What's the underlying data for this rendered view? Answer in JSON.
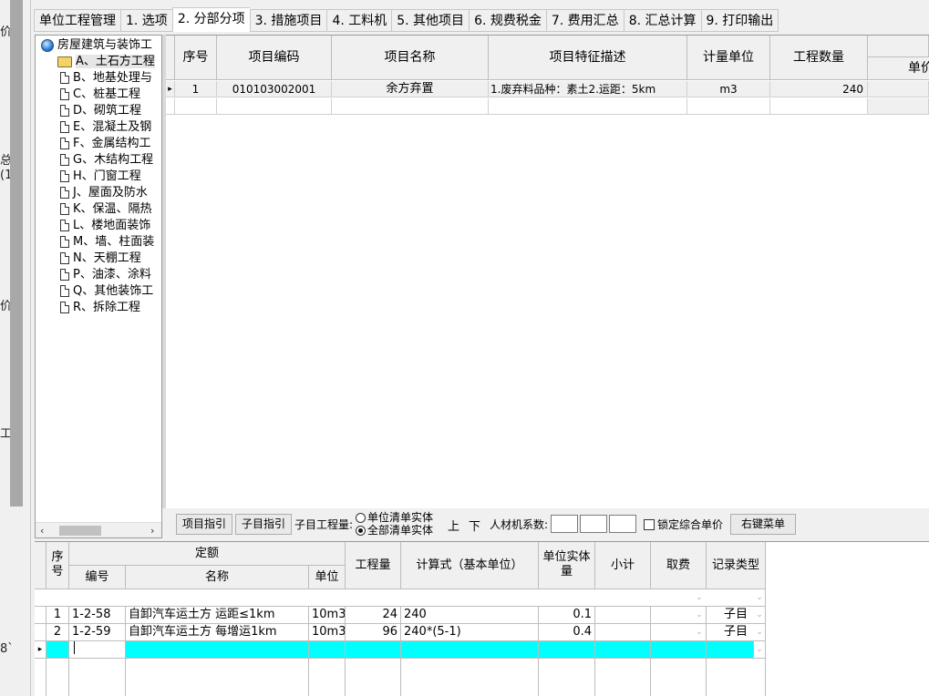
{
  "left_strip": {
    "fragments": [
      "价",
      "总",
      "(1",
      "价",
      "工",
      "8`"
    ]
  },
  "tabs": [
    "单位工程管理",
    "1. 选项",
    "2. 分部分项",
    "3. 措施项目",
    "4. 工料机",
    "5. 其他项目",
    "6. 规费税金",
    "7. 费用汇总",
    "8. 汇总计算",
    "9. 打印输出"
  ],
  "active_tab": 2,
  "tree": {
    "root": "房屋建筑与装饰工",
    "items": [
      "A、土石方工程",
      "B、地基处理与",
      "C、桩基工程",
      "D、砌筑工程",
      "E、混凝土及钢",
      "F、金属结构工",
      "G、木结构工程",
      "H、门窗工程",
      "J、屋面及防水",
      "K、保温、隔热",
      "L、楼地面装饰",
      "M、墙、柱面装",
      "N、天棚工程",
      "P、油漆、涂料",
      "Q、其他装饰工",
      "R、拆除工程"
    ],
    "selected_index": 0,
    "scroll_left": "‹",
    "scroll_right": "›"
  },
  "top_grid": {
    "headers": [
      "序号",
      "项目编码",
      "项目名称",
      "项目特征描述",
      "计量单位",
      "工程数量"
    ],
    "extra_header": "单价",
    "row_indicator": "▸",
    "rows": [
      {
        "no": "1",
        "code": "010103002001",
        "name": "余方弃置",
        "desc": "1.废弃料品种：素土2.运距：5km",
        "unit": "m3",
        "qty": "240"
      }
    ]
  },
  "toolbar": {
    "btn_project_guide": "项目指引",
    "btn_sub_guide": "子目指引",
    "sub_qty_label": "子目工程量:",
    "radio_unit": "单位清单实体",
    "radio_all": "全部清单实体",
    "up": "上",
    "down": "下",
    "labor_coef": "人材机系数:",
    "lock_price": "锁定综合单价",
    "context_menu": "右键菜单"
  },
  "bottom_grid": {
    "h_no": "序号",
    "h_quota": "定额",
    "h_code": "编号",
    "h_name": "名称",
    "h_unit": "单位",
    "h_qty": "工程量",
    "h_formula": "计算式（基本单位）",
    "h_unit_qty": "单位实体量",
    "h_subtotal": "小计",
    "h_fee": "取费",
    "h_type": "记录类型",
    "row_indicator": "▸",
    "rows": [
      {
        "no": "1",
        "code": "1-2-58",
        "name": "自卸汽车运土方 运距≤1km",
        "unit": "10m3",
        "qty": "24",
        "formula": "240",
        "unit_qty": "0.1",
        "type": "子目"
      },
      {
        "no": "2",
        "code": "1-2-59",
        "name": "自卸汽车运土方 每增运1km",
        "unit": "10m3",
        "qty": "96",
        "formula": "240*(5-1)",
        "unit_qty": "0.4",
        "type": "子目"
      }
    ]
  }
}
